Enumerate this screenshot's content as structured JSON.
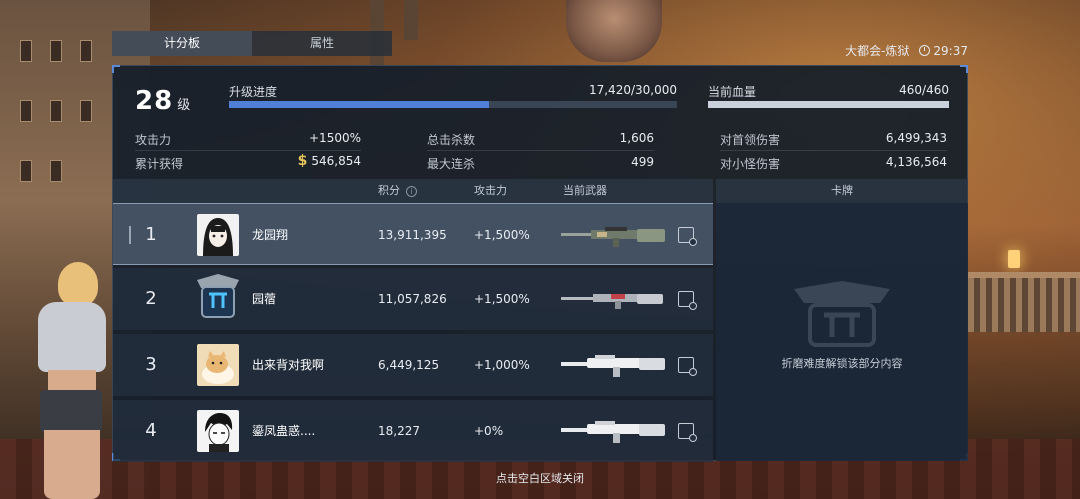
{
  "tabs": [
    {
      "label": "计分板",
      "active": true
    },
    {
      "label": "属性",
      "active": false
    }
  ],
  "map_name": "大都会-炼狱",
  "timer": "29:37",
  "level": {
    "value": "28",
    "unit": "级"
  },
  "upgrade_progress": {
    "label": "升级进度",
    "value": "17,420/30,000",
    "fraction": 0.5807
  },
  "current_hp": {
    "label": "当前血量",
    "value": "460/460",
    "fraction": 1.0
  },
  "stats": {
    "attack_label": "攻击力",
    "attack_value": "+1500%",
    "earned_label": "累计获得",
    "earned_value": "546,854",
    "kills_label": "总击杀数",
    "kills_value": "1,606",
    "combo_label": "最大连杀",
    "combo_value": "499",
    "boss_dmg_label": "对首领伤害",
    "boss_dmg_value": "6,499,343",
    "minion_dmg_label": "对小怪伤害",
    "minion_dmg_value": "4,136,564"
  },
  "table": {
    "headers": {
      "score": "积分",
      "attack": "攻击力",
      "weapon": "当前武器",
      "card": "卡牌"
    },
    "rows": [
      {
        "rank": "1",
        "name": "龙园翔",
        "score": "13,911,395",
        "attack": "+1,500%",
        "avatar": "anime-girl-avatar",
        "weapon": "rifle-camo"
      },
      {
        "rank": "2",
        "name": "园蓿",
        "score": "11,057,826",
        "attack": "+1,500%",
        "avatar": "emblem-avatar",
        "weapon": "rifle-silver-red"
      },
      {
        "rank": "3",
        "name": "出来背对我啊",
        "score": "6,449,125",
        "attack": "+1,000%",
        "avatar": "cat-avatar",
        "weapon": "rifle-white"
      },
      {
        "rank": "4",
        "name": "鎏凤蛊惑....",
        "score": "18,227",
        "attack": "+0%",
        "avatar": "manga-boy-avatar",
        "weapon": "rifle-white"
      }
    ]
  },
  "card_locked_text": "折磨难度解锁该部分内容",
  "footer_hint": "点击空白区域关闭",
  "colors": {
    "progress_fill": "#4f7fd6",
    "hp_fill": "#c9d2dc",
    "accent": "#5b8ad8"
  }
}
